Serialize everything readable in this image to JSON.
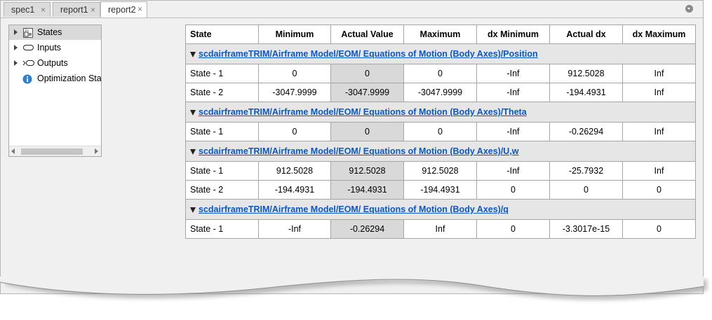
{
  "tabs": [
    {
      "label": "spec1",
      "active": false
    },
    {
      "label": "report1",
      "active": false
    },
    {
      "label": "report2",
      "active": true
    }
  ],
  "close_glyph": "×",
  "tree": {
    "items": [
      {
        "label": "States",
        "icon": "states-block-icon",
        "expandable": true,
        "selected": true
      },
      {
        "label": "Inputs",
        "icon": "inport-icon",
        "expandable": true,
        "selected": false
      },
      {
        "label": "Outputs",
        "icon": "outport-icon",
        "expandable": true,
        "selected": false
      },
      {
        "label": "Optimization Stat",
        "icon": "info-icon",
        "expandable": false,
        "selected": false
      }
    ]
  },
  "table": {
    "headers": [
      "State",
      "Minimum",
      "Actual Value",
      "Maximum",
      "dx Minimum",
      "Actual dx",
      "dx Maximum"
    ],
    "groups": [
      {
        "path": "scdairframeTRIM/Airframe Model/EOM/ Equations of Motion (Body Axes)/Position",
        "rows": [
          [
            "State - 1",
            "0",
            "0",
            "0",
            "-Inf",
            "912.5028",
            "Inf"
          ],
          [
            "State - 2",
            "-3047.9999",
            "-3047.9999",
            "-3047.9999",
            "-Inf",
            "-194.4931",
            "Inf"
          ]
        ]
      },
      {
        "path": "scdairframeTRIM/Airframe Model/EOM/ Equations of Motion (Body Axes)/Theta",
        "rows": [
          [
            "State - 1",
            "0",
            "0",
            "0",
            "-Inf",
            "-0.26294",
            "Inf"
          ]
        ]
      },
      {
        "path": "scdairframeTRIM/Airframe Model/EOM/ Equations of Motion (Body Axes)/U,w",
        "rows": [
          [
            "State - 1",
            "912.5028",
            "912.5028",
            "912.5028",
            "-Inf",
            "-25.7932",
            "Inf"
          ],
          [
            "State - 2",
            "-194.4931",
            "-194.4931",
            "-194.4931",
            "0",
            "0",
            "0"
          ]
        ]
      },
      {
        "path": "scdairframeTRIM/Airframe Model/EOM/ Equations of Motion (Body Axes)/q",
        "rows": [
          [
            "State - 1",
            "-Inf",
            "-0.26294",
            "Inf",
            "0",
            "-3.3017e-15",
            "0"
          ]
        ]
      }
    ]
  },
  "colors": {
    "link": "#0a57c9",
    "actual_cell": "#d9d9d9",
    "group_row": "#e6e6e6",
    "panel_bg": "#f0f0f0"
  }
}
